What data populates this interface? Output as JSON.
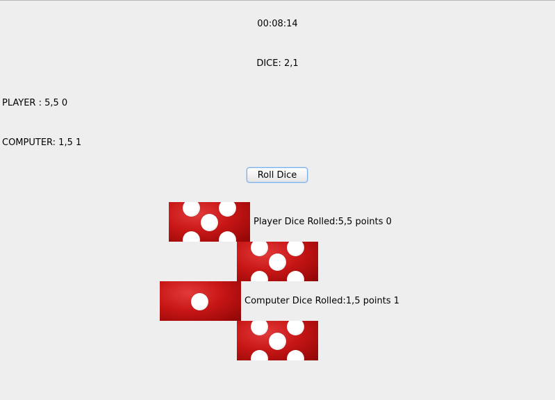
{
  "timer": "00:08:14",
  "dice_line": "DICE: 2,1",
  "player_line": "PLAYER : 5,5 0",
  "computer_line": "COMPUTER: 1,5 1",
  "roll_button_label": "Roll Dice",
  "player_rolled_text": "Player Dice Rolled:5,5 points 0",
  "computer_rolled_text": "Computer Dice Rolled:1,5 points 1",
  "dice_faces": {
    "player_die_1": 5,
    "player_die_2": 5,
    "computer_die_1": 1,
    "computer_die_2": 5
  },
  "colors": {
    "background": "#eeeeee",
    "die_red": "#c81616",
    "pip_white": "#ffffff",
    "button_focus": "#79aee8"
  }
}
